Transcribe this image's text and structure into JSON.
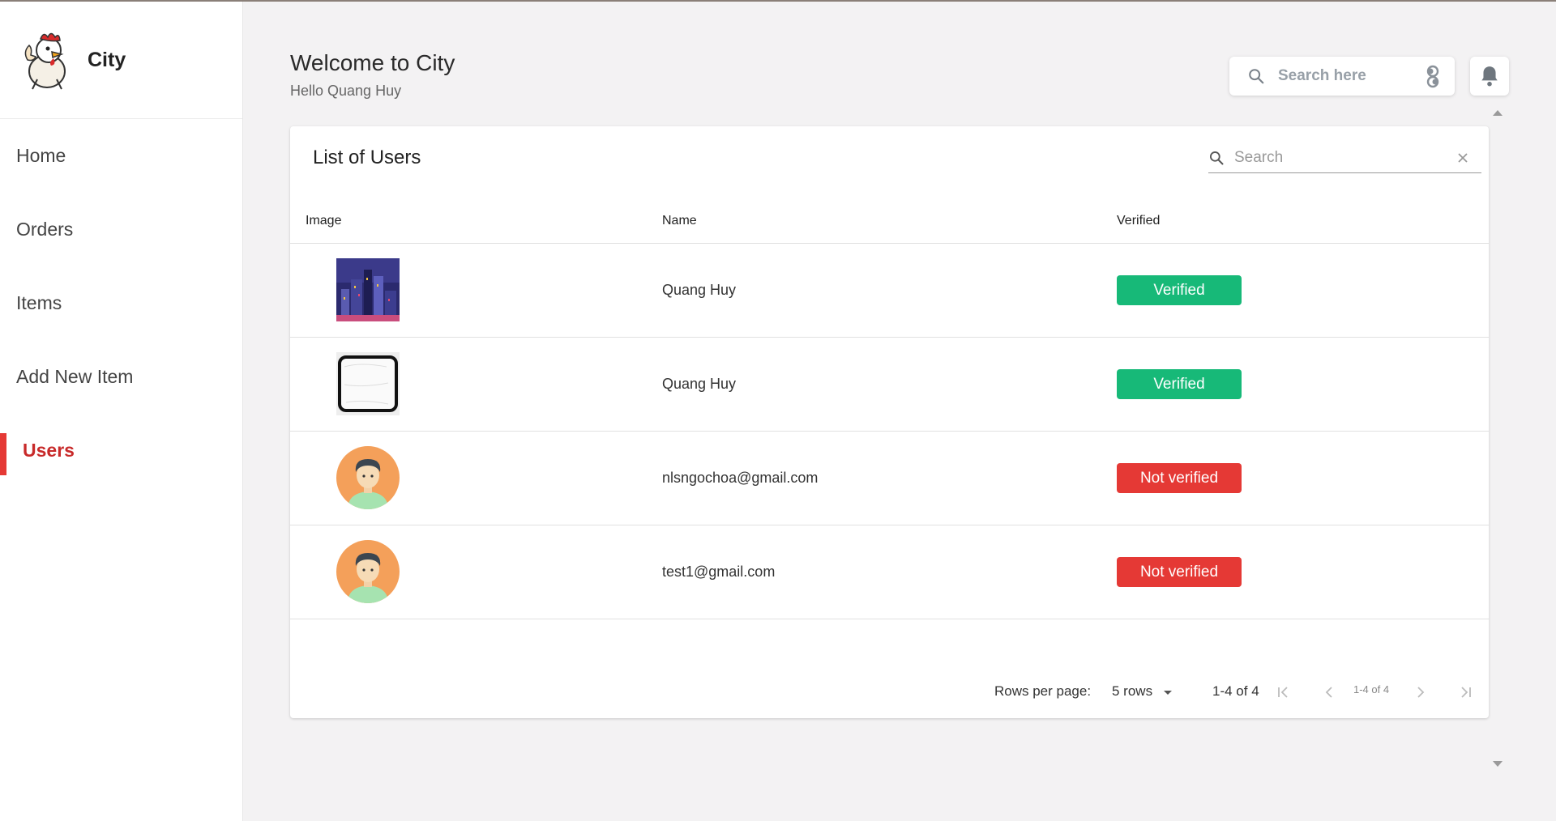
{
  "app": {
    "name": "City"
  },
  "sidebar": {
    "items": [
      {
        "label": "Home",
        "active": false
      },
      {
        "label": "Orders",
        "active": false
      },
      {
        "label": "Items",
        "active": false
      },
      {
        "label": "Add New Item",
        "active": false
      },
      {
        "label": "Users",
        "active": true
      }
    ]
  },
  "header": {
    "title": "Welcome to City",
    "subtitle": "Hello Quang Huy",
    "search_placeholder": "Search here"
  },
  "card": {
    "title": "List of Users",
    "search_placeholder": "Search",
    "columns": [
      "Image",
      "Name",
      "Verified"
    ],
    "rows": [
      {
        "image": "city-night-thumbnail",
        "name": "Quang Huy",
        "status": "Verified",
        "verified": true
      },
      {
        "image": "bull-shit-sticker-thumbnail",
        "name": "Quang Huy",
        "status": "Verified",
        "verified": true
      },
      {
        "image": "default-avatar",
        "name": "nlsngochoa@gmail.com",
        "status": "Not verified",
        "verified": false
      },
      {
        "image": "default-avatar",
        "name": "test1@gmail.com",
        "status": "Not verified",
        "verified": false
      }
    ]
  },
  "pagination": {
    "rows_per_page_label": "Rows per page:",
    "rows_per_page_value": "5 rows",
    "range": "1-4 of 4",
    "range_small": "1-4 of 4"
  },
  "colors": {
    "accent": "#e53935",
    "verified": "#17b978",
    "not_verified": "#e53935"
  }
}
